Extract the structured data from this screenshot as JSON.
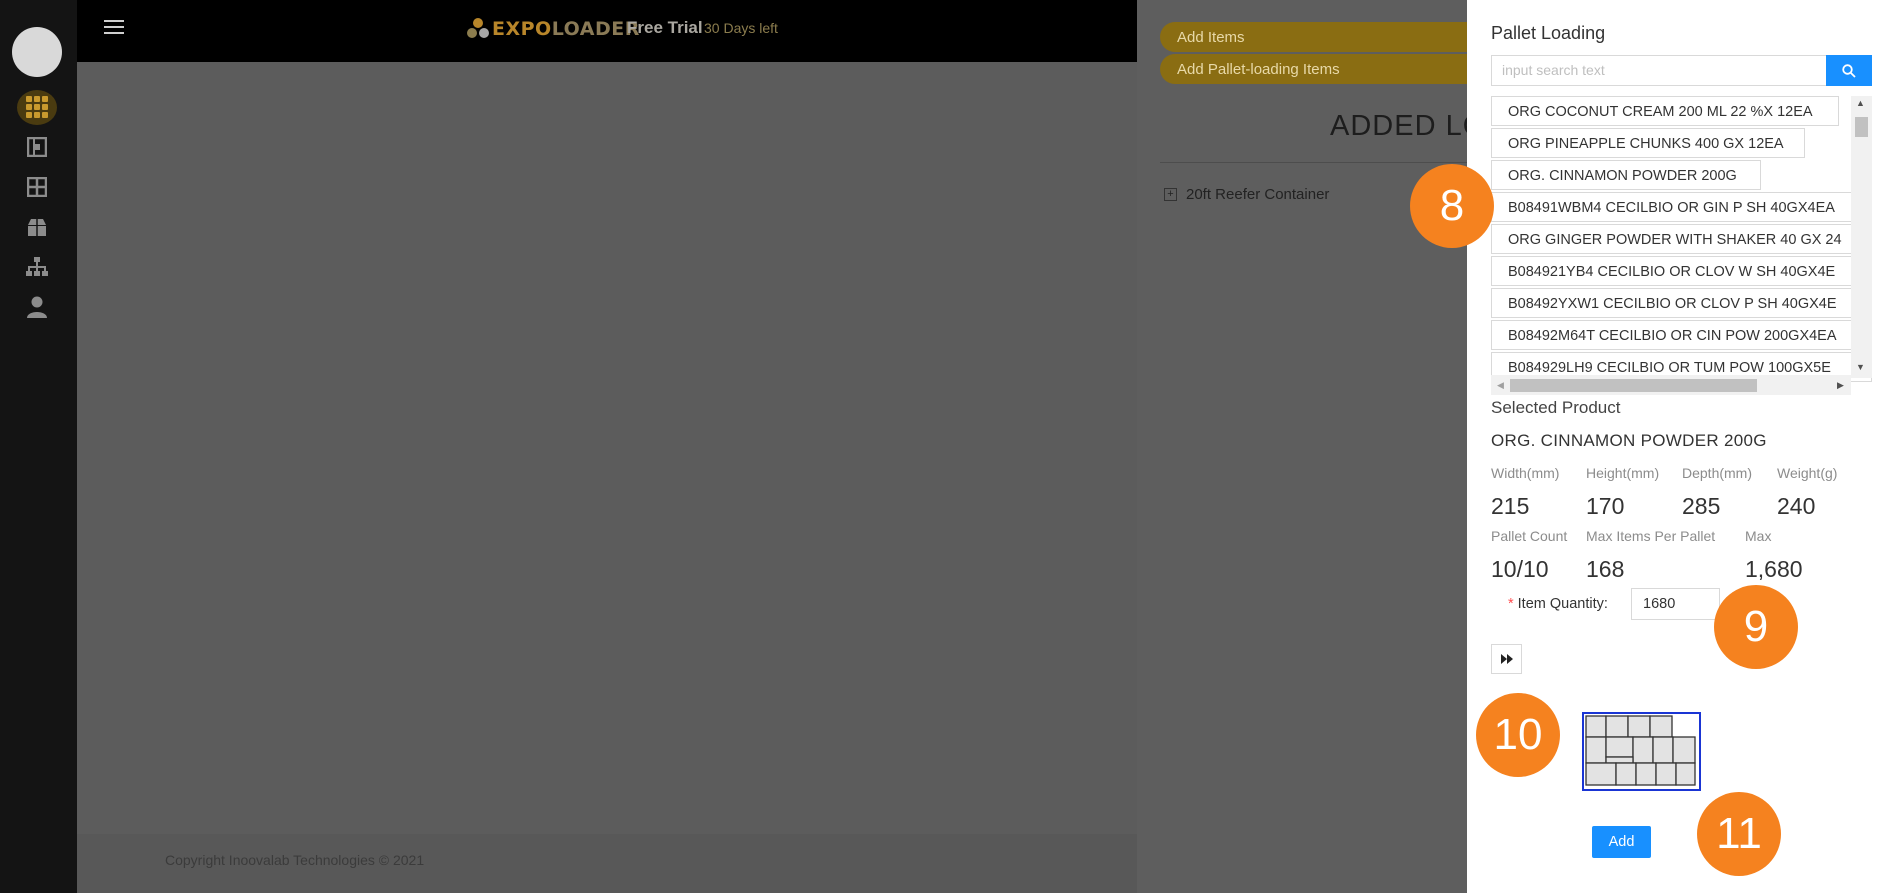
{
  "header": {
    "brand_prefix": "EXPO",
    "brand_suffix": "LOADER",
    "plan": "Free Trial",
    "days_left": "30 Days left"
  },
  "sidebar": {
    "items": [
      {
        "icon": "grid-icon",
        "active": true
      },
      {
        "icon": "layout-icon",
        "active": false
      },
      {
        "icon": "windows-icon",
        "active": false
      },
      {
        "icon": "box-icon",
        "active": false
      },
      {
        "icon": "org-chart-icon",
        "active": false
      },
      {
        "icon": "user-icon",
        "active": false
      }
    ]
  },
  "footer": {
    "copyright": "Copyright Inoovalab Technologies © 2021"
  },
  "middle": {
    "add_items": "Add Items",
    "add_pallet_items": "Add Pallet-loading Items",
    "added_title": "ADDED LOADS",
    "tree_item": "20ft Reefer Container"
  },
  "drawer": {
    "title": "Pallet Loading",
    "search_placeholder": "input search text",
    "products": [
      "ORG COCONUT CREAM 200 ML 22 %X 12EA",
      "ORG PINEAPPLE CHUNKS 400 GX 12EA",
      "ORG. CINNAMON POWDER 200G",
      "B08491WBM4 CECILBIO OR GIN P SH 40GX4EA",
      "ORG GINGER POWDER WITH SHAKER 40 GX 24",
      "B084921YB4 CECILBIO OR CLOV W SH 40GX4E",
      "B08492YXW1 CECILBIO OR CLOV P SH 40GX4E",
      "B08492M64T CECILBIO OR CIN POW 200GX4EA",
      "B084929LH9 CECILBIO OR TUM POW 100GX5E"
    ],
    "selected_label": "Selected Product",
    "selected_name": "ORG. CINNAMON POWDER 200G",
    "dims": {
      "width_label": "Width(mm)",
      "width": "215",
      "height_label": "Height(mm)",
      "height": "170",
      "depth_label": "Depth(mm)",
      "depth": "285",
      "weight_label": "Weight(g)",
      "weight": "240"
    },
    "pallet": {
      "count_label": "Pallet Count",
      "count": "10/10",
      "max_per_label": "Max Items Per Pallet",
      "max_per": "168",
      "max_label": "Max",
      "max": "1,680"
    },
    "qty_label": "Item Quantity",
    "qty_value": "1680",
    "add_label": "Add"
  },
  "badges": {
    "b8": "8",
    "b9": "9",
    "b10": "10",
    "b11": "11"
  },
  "colors": {
    "accent": "#1890ff",
    "brand": "#b8862a",
    "badge": "#f5821f"
  }
}
